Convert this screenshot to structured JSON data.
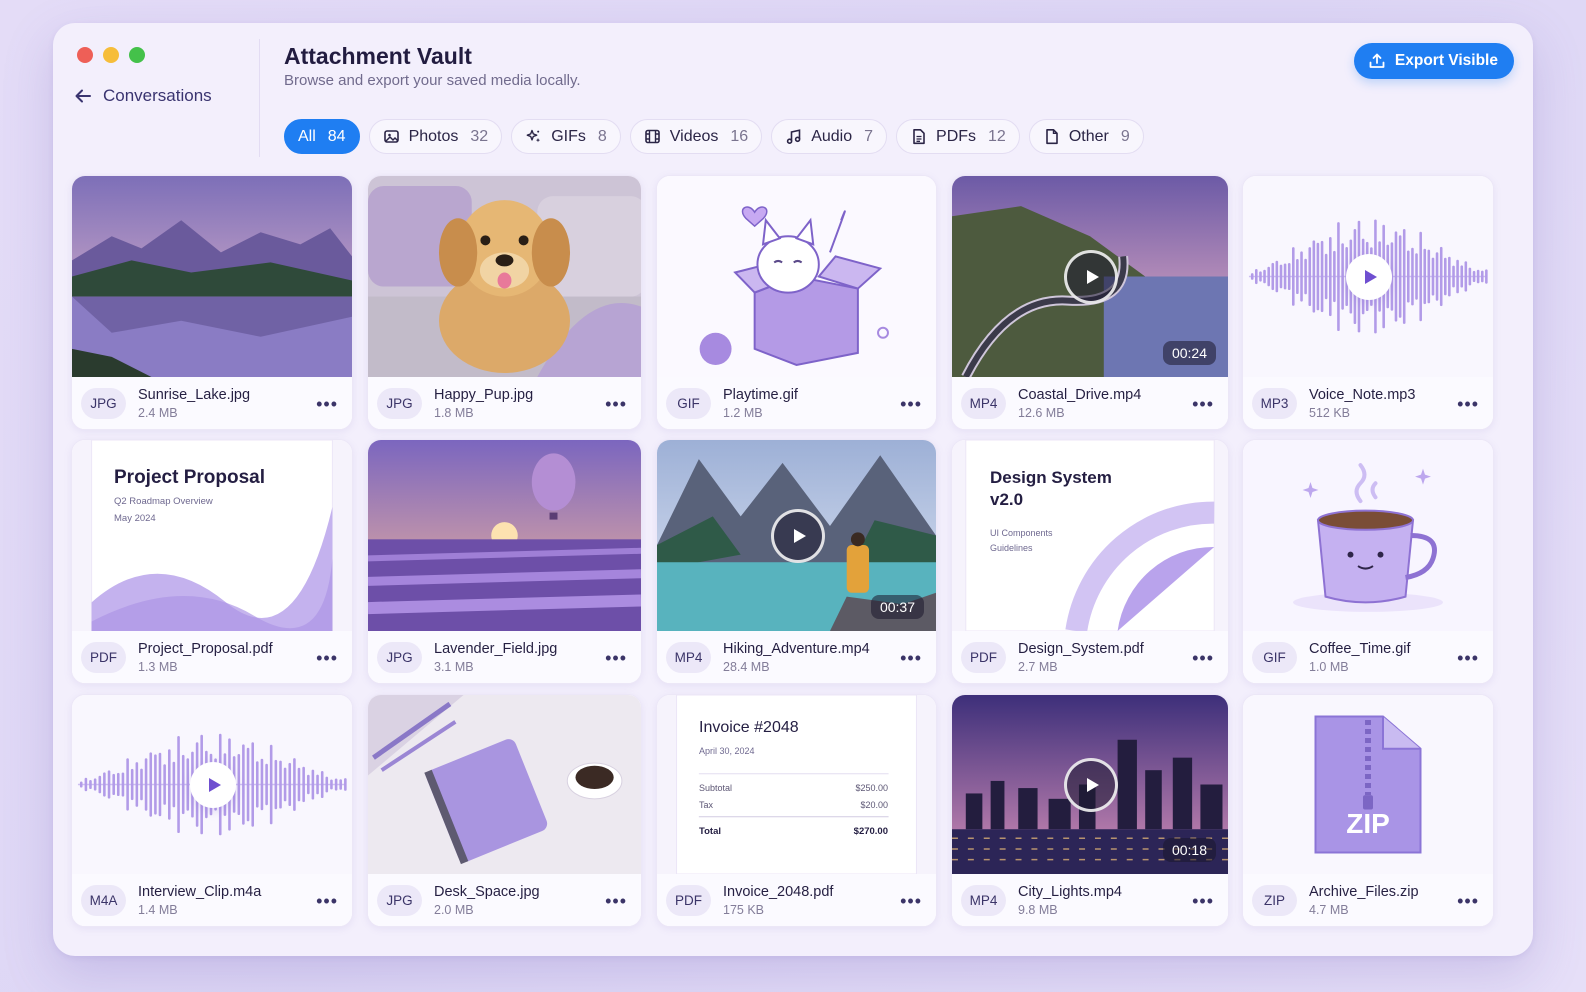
{
  "window": {
    "title": "Attachment Vault",
    "subtitle": "Browse and export your saved media locally.",
    "back_label": "Conversations",
    "export_label": "Export Visible"
  },
  "filters": [
    {
      "label": "All",
      "count": "84",
      "icon": "grid-icon",
      "active": true
    },
    {
      "label": "Photos",
      "count": "32",
      "icon": "image-icon",
      "active": false
    },
    {
      "label": "GIFs",
      "count": "8",
      "icon": "sparkles-icon",
      "active": false
    },
    {
      "label": "Videos",
      "count": "16",
      "icon": "film-icon",
      "active": false
    },
    {
      "label": "Audio",
      "count": "7",
      "icon": "music-note-icon",
      "active": false
    },
    {
      "label": "PDFs",
      "count": "12",
      "icon": "document-icon",
      "active": false
    },
    {
      "label": "Other",
      "count": "9",
      "icon": "file-icon",
      "active": false
    }
  ],
  "items": [
    {
      "name": "Sunrise_Lake.jpg",
      "size": "2.4 MB",
      "type": "JPG",
      "kind": "lake"
    },
    {
      "name": "Happy_Pup.jpg",
      "size": "1.8 MB",
      "type": "JPG",
      "kind": "pup"
    },
    {
      "name": "Playtime.gif",
      "size": "1.2 MB",
      "type": "GIF",
      "kind": "cat"
    },
    {
      "name": "Coastal_Drive.mp4",
      "size": "12.6 MB",
      "type": "MP4",
      "kind": "coast",
      "duration": "00:24"
    },
    {
      "name": "Voice_Note.mp3",
      "size": "512 KB",
      "type": "MP3",
      "kind": "wave"
    },
    {
      "name": "Project_Proposal.pdf",
      "size": "1.3 MB",
      "type": "PDF",
      "kind": "proposal"
    },
    {
      "name": "Lavender_Field.jpg",
      "size": "3.1 MB",
      "type": "JPG",
      "kind": "lavender"
    },
    {
      "name": "Hiking_Adventure.mp4",
      "size": "28.4 MB",
      "type": "MP4",
      "kind": "hike",
      "duration": "00:37"
    },
    {
      "name": "Design_System.pdf",
      "size": "2.7 MB",
      "type": "PDF",
      "kind": "design"
    },
    {
      "name": "Coffee_Time.gif",
      "size": "1.0 MB",
      "type": "GIF",
      "kind": "coffee"
    },
    {
      "name": "Interview_Clip.m4a",
      "size": "1.4 MB",
      "type": "M4A",
      "kind": "wave"
    },
    {
      "name": "Desk_Space.jpg",
      "size": "2.0 MB",
      "type": "JPG",
      "kind": "desk"
    },
    {
      "name": "Invoice_2048.pdf",
      "size": "175 KB",
      "type": "PDF",
      "kind": "invoice"
    },
    {
      "name": "City_Lights.mp4",
      "size": "9.8 MB",
      "type": "MP4",
      "kind": "city",
      "duration": "00:18"
    },
    {
      "name": "Archive_Files.zip",
      "size": "4.7 MB",
      "type": "ZIP",
      "kind": "zip"
    }
  ],
  "previews": {
    "proposal": {
      "title": "Project Proposal",
      "line1": "Q2 Roadmap Overview",
      "line2": "May 2024"
    },
    "design": {
      "title1": "Design System",
      "title2": "v2.0",
      "line1": "UI Components",
      "line2": "Guidelines"
    },
    "invoice": {
      "title": "Invoice #2048",
      "date": "April 30, 2024",
      "rows": [
        {
          "label": "Subtotal",
          "value": "$250.00"
        },
        {
          "label": "Tax",
          "value": "$20.00"
        }
      ],
      "total_label": "Total",
      "total_value": "$270.00"
    },
    "zip_label": "ZIP"
  },
  "colors": {
    "accent": "#1f7ef2",
    "lavender": "#a48ae0",
    "window_bg": "#f3effc"
  }
}
